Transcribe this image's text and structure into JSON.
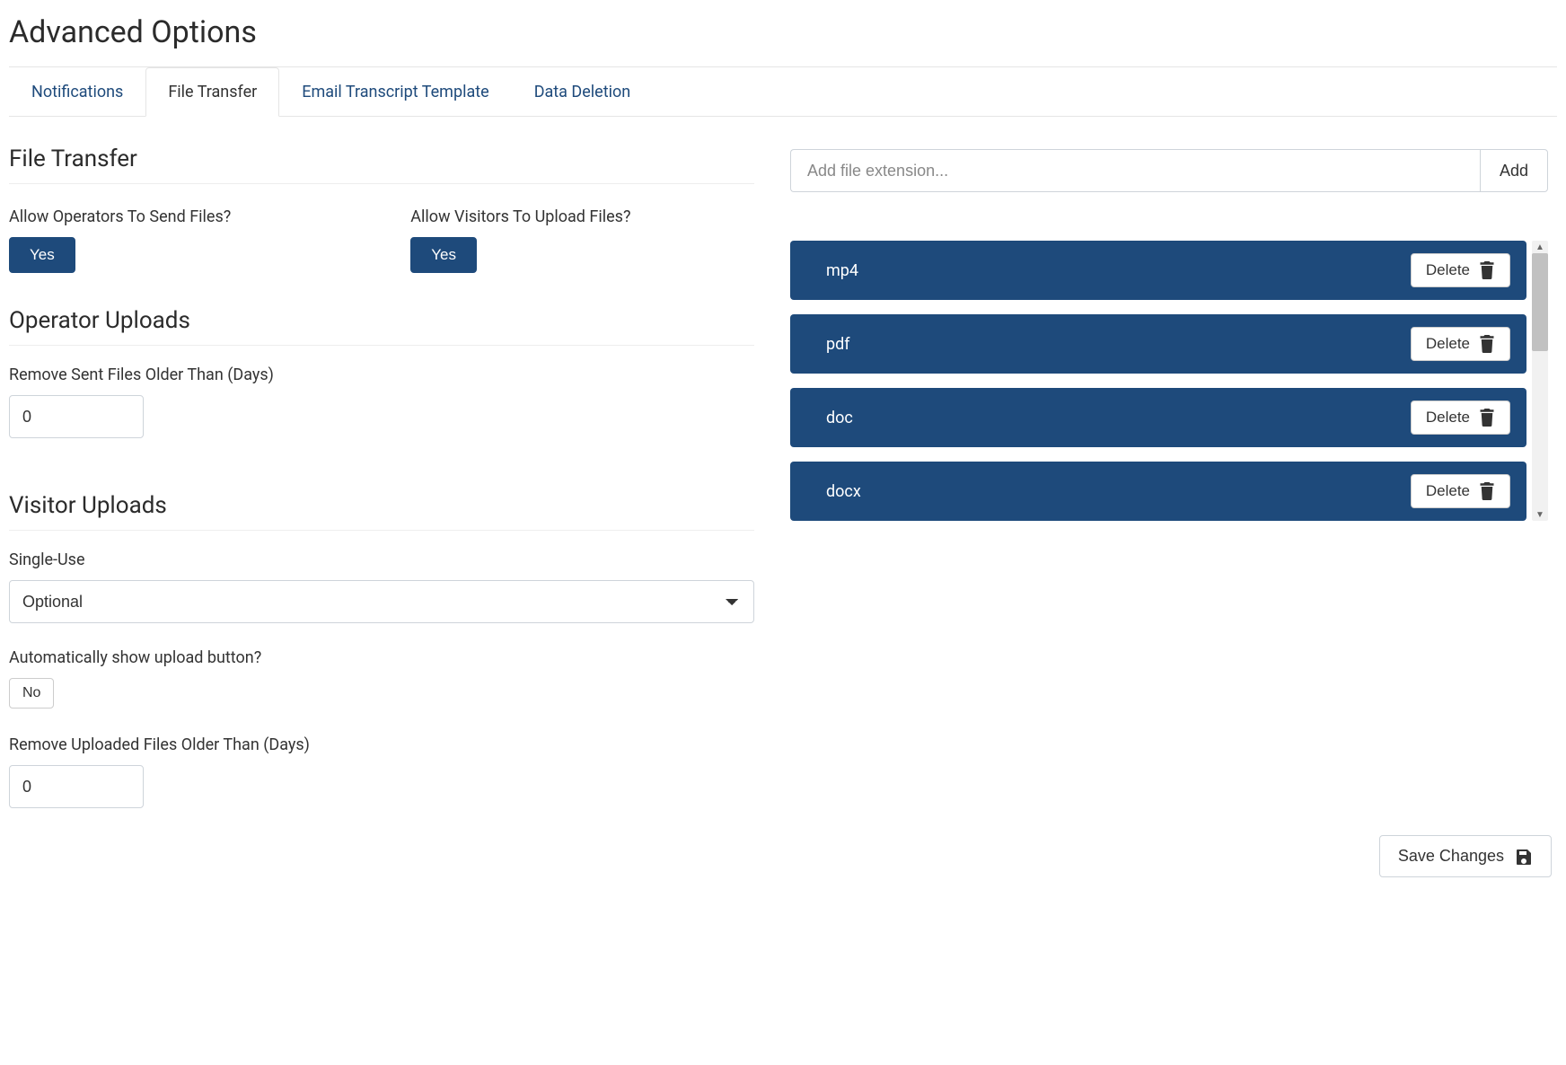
{
  "page_title": "Advanced Options",
  "tabs": {
    "notifications": "Notifications",
    "file_transfer": "File Transfer",
    "email_transcript": "Email Transcript Template",
    "data_deletion": "Data Deletion",
    "active": "file_transfer"
  },
  "sections": {
    "file_transfer_heading": "File Transfer",
    "operator_uploads_heading": "Operator Uploads",
    "visitor_uploads_heading": "Visitor Uploads"
  },
  "fields": {
    "allow_operators_label": "Allow Operators To Send Files?",
    "allow_operators_value": "Yes",
    "allow_visitors_label": "Allow Visitors To Upload Files?",
    "allow_visitors_value": "Yes",
    "remove_sent_label": "Remove Sent Files Older Than (Days)",
    "remove_sent_value": "0",
    "single_use_label": "Single-Use",
    "single_use_value": "Optional",
    "auto_show_label": "Automatically show upload button?",
    "auto_show_value": "No",
    "remove_uploaded_label": "Remove Uploaded Files Older Than (Days)",
    "remove_uploaded_value": "0"
  },
  "extension_input": {
    "placeholder": "Add file extension...",
    "add_button": "Add"
  },
  "extensions": [
    {
      "name": "mp4",
      "delete_label": "Delete"
    },
    {
      "name": "pdf",
      "delete_label": "Delete"
    },
    {
      "name": "doc",
      "delete_label": "Delete"
    },
    {
      "name": "docx",
      "delete_label": "Delete"
    }
  ],
  "footer": {
    "save_label": "Save Changes"
  }
}
